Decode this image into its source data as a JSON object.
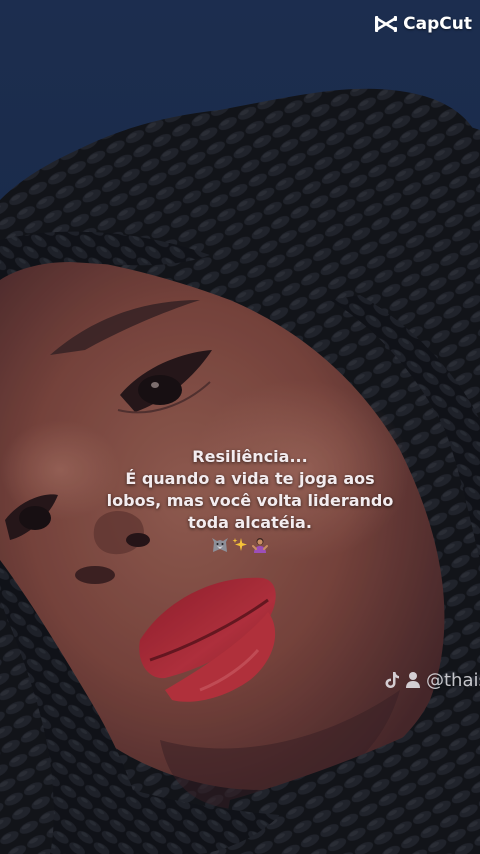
{
  "brand": {
    "name": "CapCut",
    "icon": "capcut-logo-icon"
  },
  "caption": {
    "lines": [
      "Resiliência...",
      "É quando a vida te joga aos",
      "lobos, mas você volta liderando",
      "toda alcatéia."
    ],
    "emoji_icons": [
      "wolf-icon",
      "sparkles-icon",
      "woman-gesturing-icon"
    ]
  },
  "watermark": {
    "icons": [
      "tiktok-icon",
      "user-icon"
    ],
    "handle": "@thais"
  },
  "colors": {
    "sky": "#1a2c4f",
    "hair": "#15161c",
    "skin": "#8a4f43",
    "lips": "#b72a35",
    "caption_text": "#f3ecef"
  }
}
